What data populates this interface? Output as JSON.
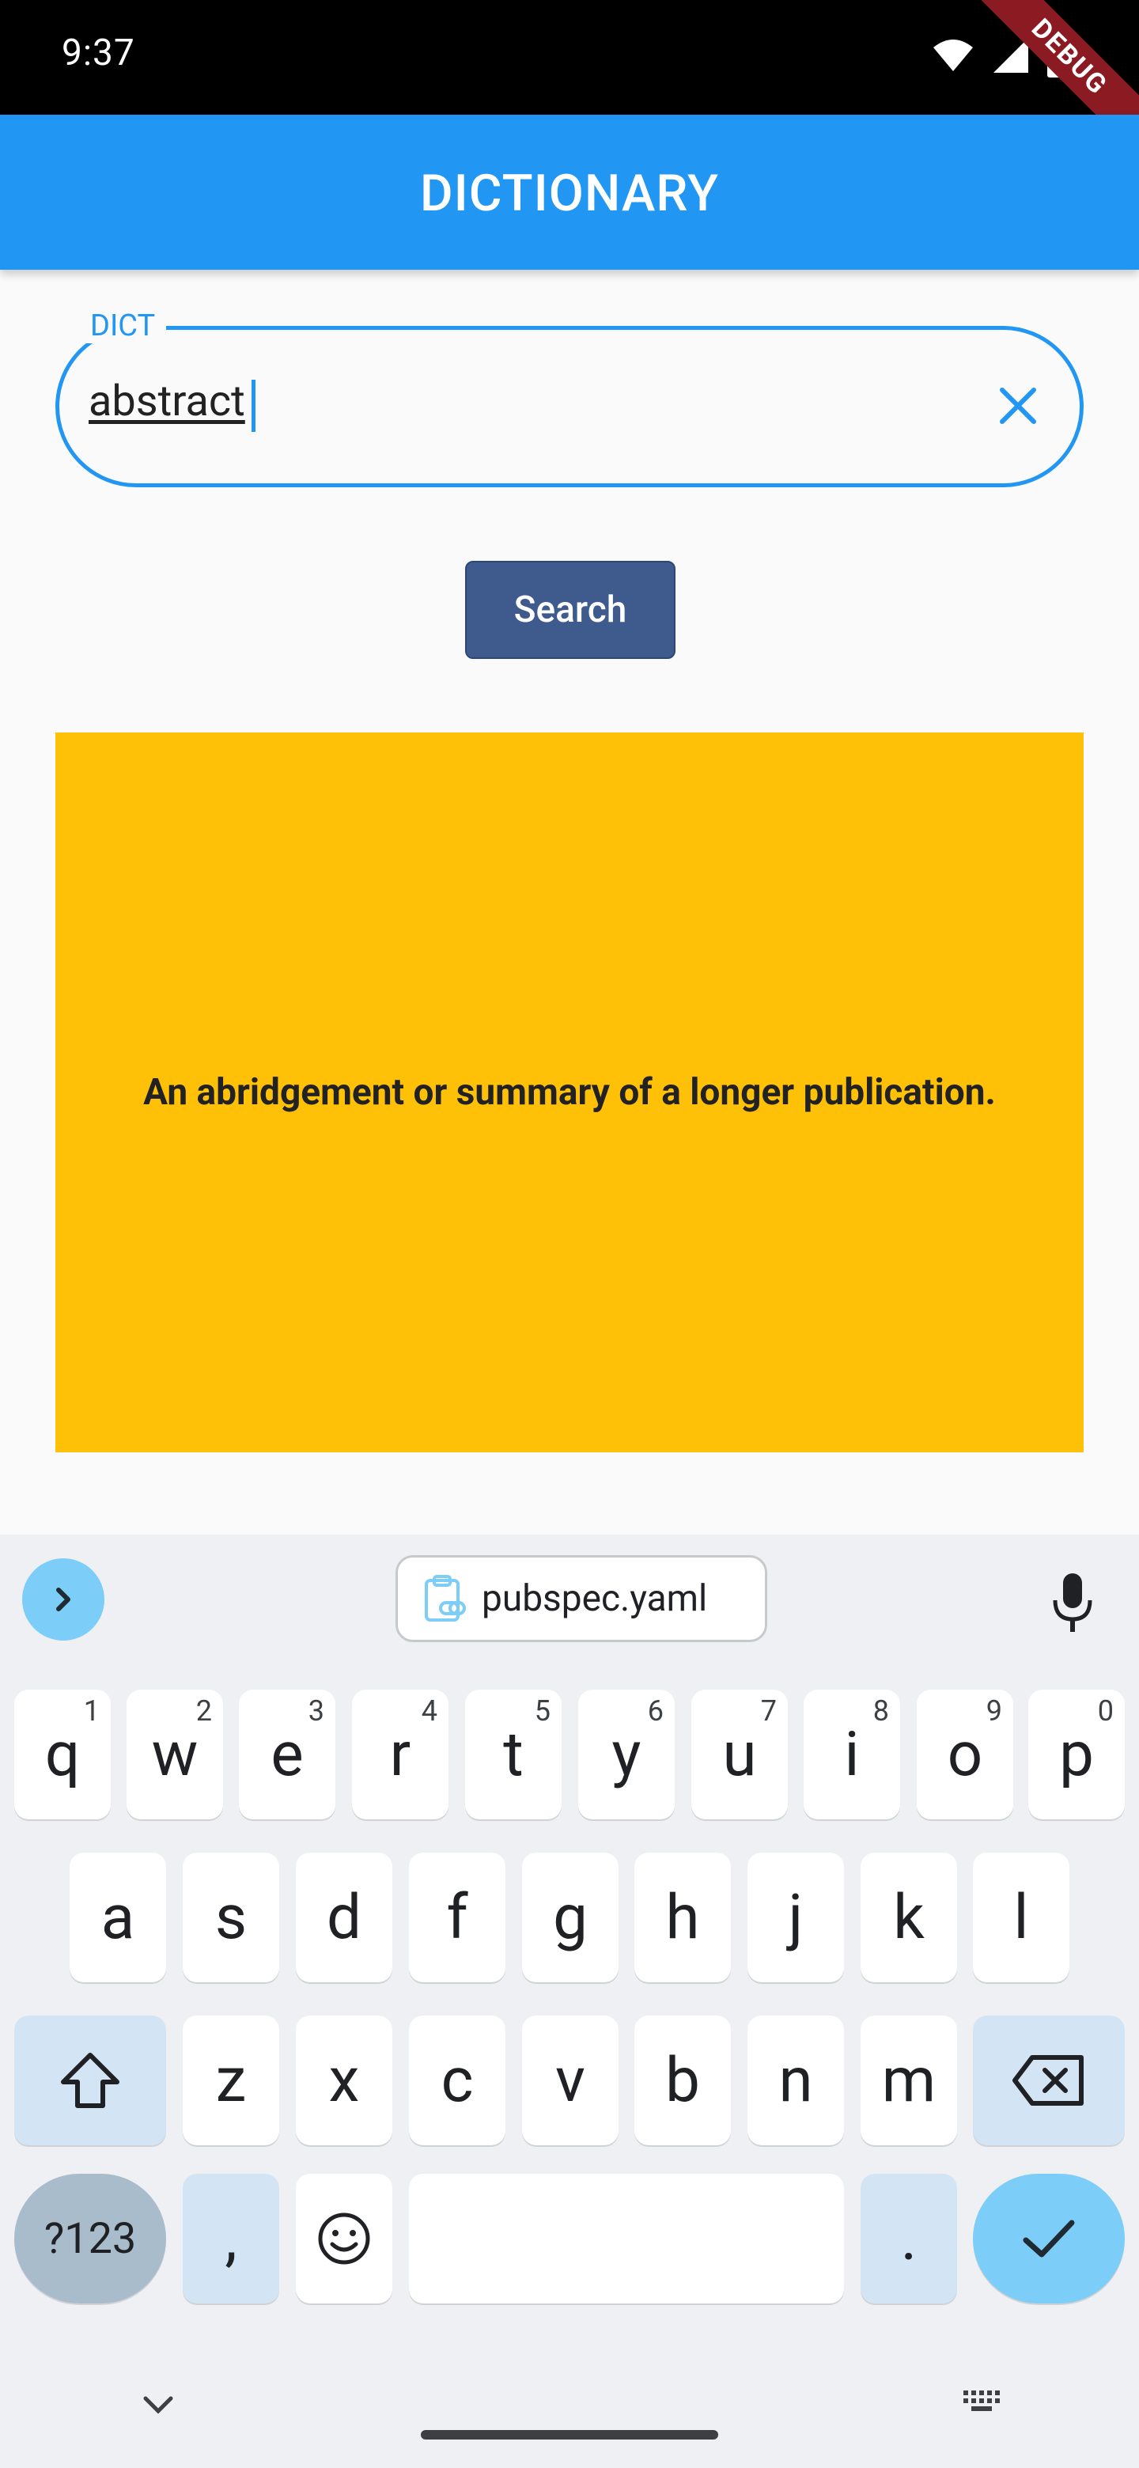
{
  "status_bar": {
    "time": "9:37"
  },
  "debug_ribbon": "DEBUG",
  "app_bar": {
    "title": "DICTIONARY"
  },
  "search_field": {
    "label": "DICT",
    "value": "abstract"
  },
  "search_button": {
    "label": "Search"
  },
  "definition": {
    "text": "An abridgement or summary of a longer publication."
  },
  "keyboard": {
    "clipboard_chip": "pubspec.yaml",
    "row1": [
      {
        "key": "q",
        "hint": "1"
      },
      {
        "key": "w",
        "hint": "2"
      },
      {
        "key": "e",
        "hint": "3"
      },
      {
        "key": "r",
        "hint": "4"
      },
      {
        "key": "t",
        "hint": "5"
      },
      {
        "key": "y",
        "hint": "6"
      },
      {
        "key": "u",
        "hint": "7"
      },
      {
        "key": "i",
        "hint": "8"
      },
      {
        "key": "o",
        "hint": "9"
      },
      {
        "key": "p",
        "hint": "0"
      }
    ],
    "row2": [
      "a",
      "s",
      "d",
      "f",
      "g",
      "h",
      "j",
      "k",
      "l"
    ],
    "row3": [
      "z",
      "x",
      "c",
      "v",
      "b",
      "n",
      "m"
    ],
    "symbols_label": "?123",
    "comma": ",",
    "period": "."
  },
  "colors": {
    "app_bar": "#2196f3",
    "search_button": "#3f5b8e",
    "definition_card": "#ffc107",
    "accent": "#7ccdf8"
  },
  "icons": [
    "wifi-icon",
    "signal-icon",
    "battery-icon",
    "clear-icon",
    "chevron-right-icon",
    "clipboard-link-icon",
    "mic-icon",
    "shift-icon",
    "backspace-icon",
    "emoji-icon",
    "check-icon",
    "chevron-down-icon",
    "keyboard-switch-icon"
  ]
}
